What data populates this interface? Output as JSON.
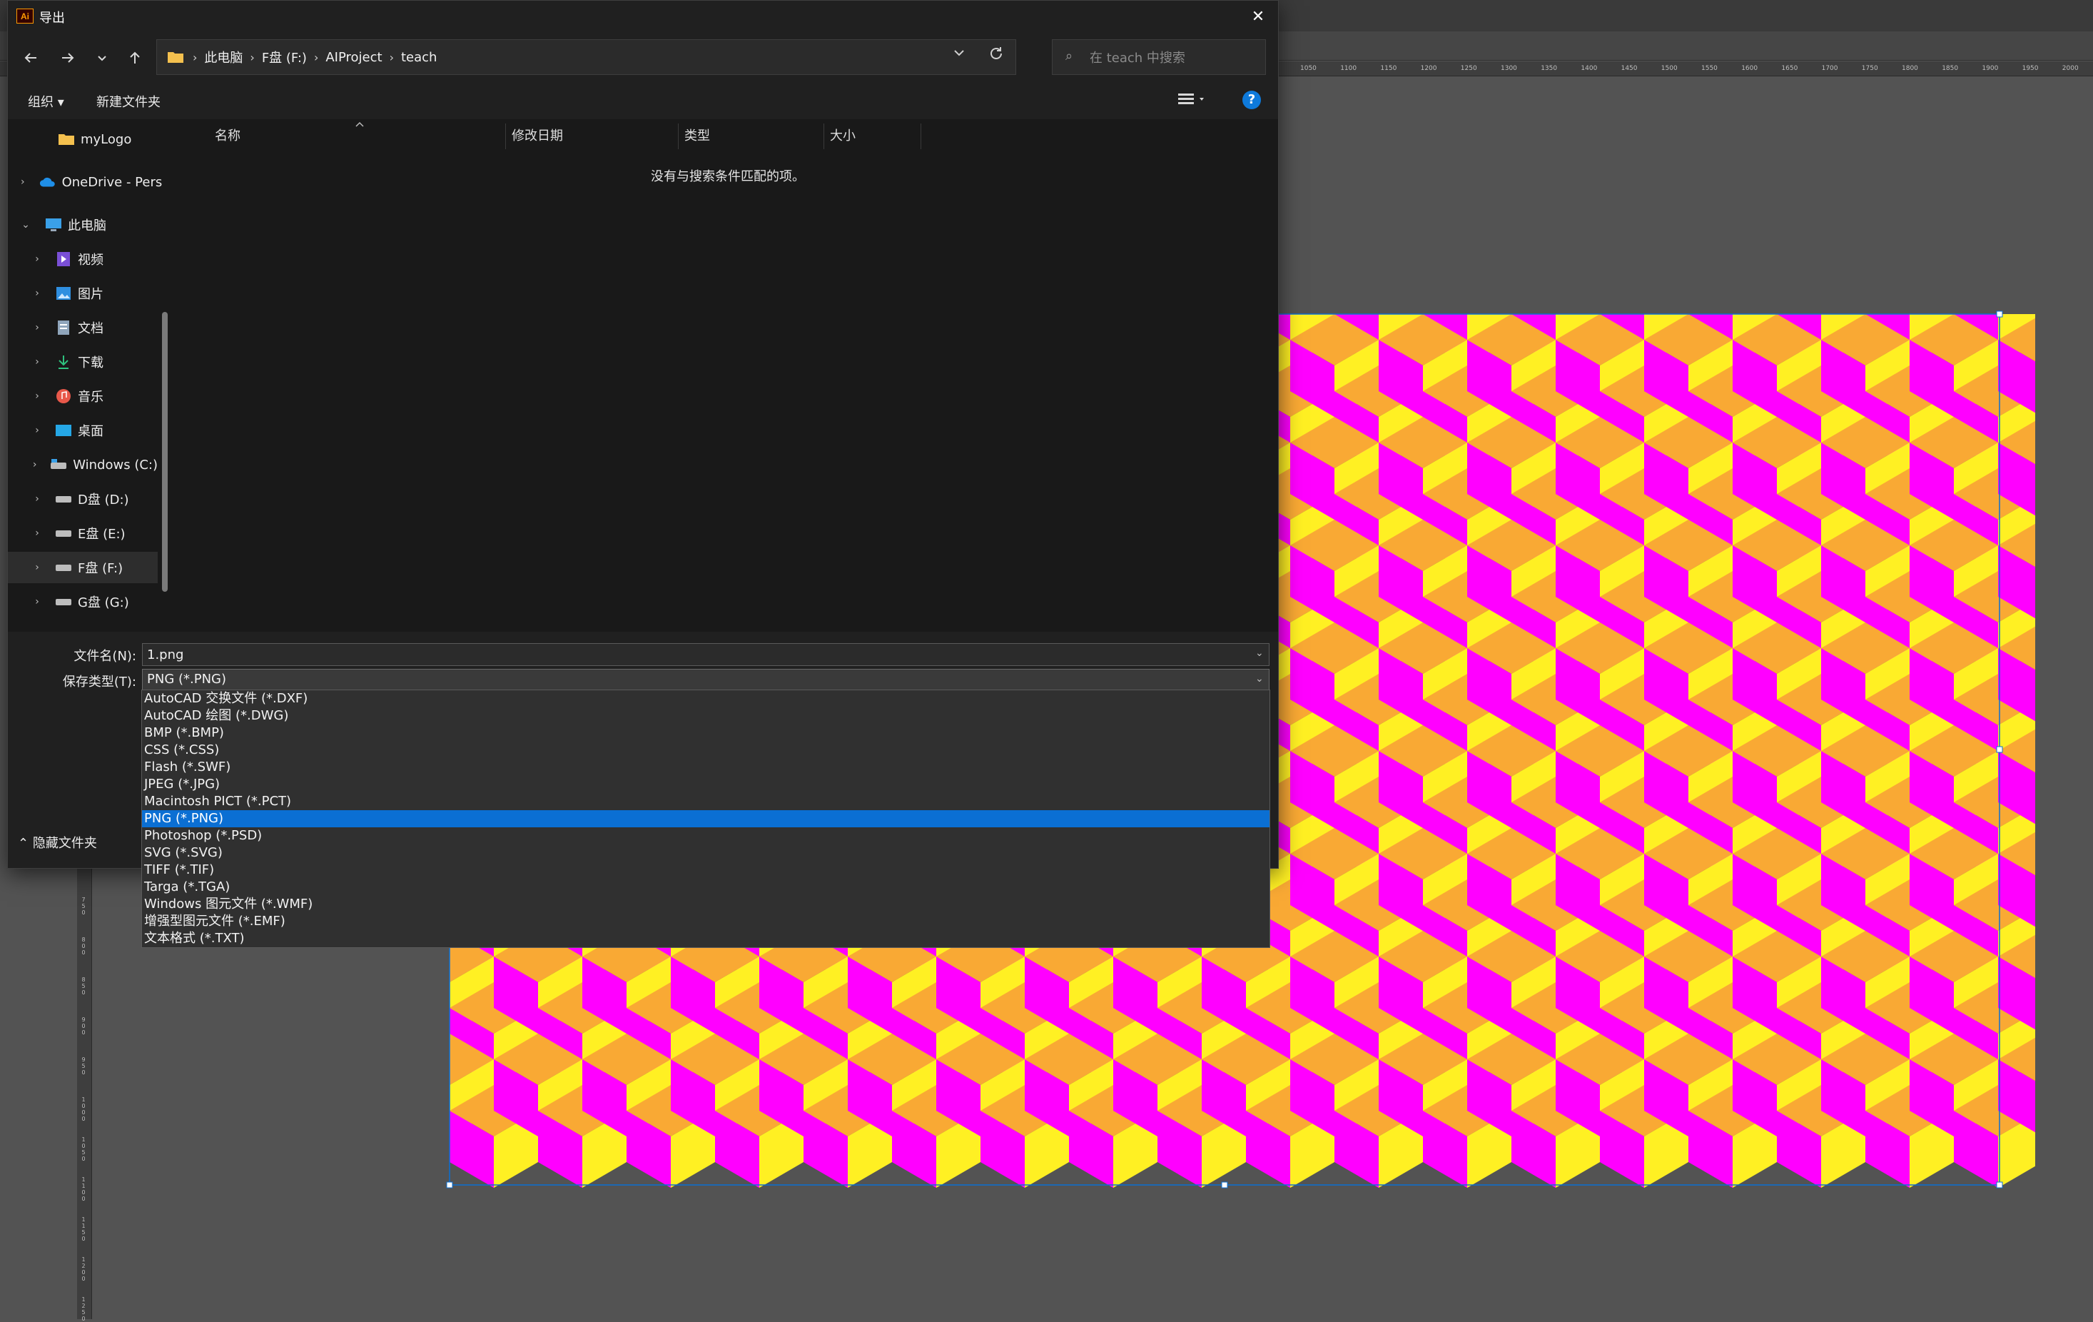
{
  "dialog": {
    "title": "导出",
    "app_icon": "Ai",
    "close": "✕"
  },
  "nav": {
    "breadcrumb": [
      "此电脑",
      "F盘 (F:)",
      "AIProject",
      "teach"
    ],
    "search_placeholder": "在 teach 中搜索"
  },
  "toolbar": {
    "organize": "组织 ▾",
    "new_folder": "新建文件夹",
    "help": "?"
  },
  "sidebar": {
    "items": [
      {
        "label": "myLogo",
        "icon": "folder-icon"
      },
      {
        "label": "OneDrive - Pers",
        "icon": "onedrive-icon"
      },
      {
        "label": "此电脑",
        "icon": "computer-icon"
      },
      {
        "label": "视频",
        "icon": "video-icon"
      },
      {
        "label": "图片",
        "icon": "pictures-icon"
      },
      {
        "label": "文档",
        "icon": "documents-icon"
      },
      {
        "label": "下载",
        "icon": "download-icon"
      },
      {
        "label": "音乐",
        "icon": "music-icon"
      },
      {
        "label": "桌面",
        "icon": "desktop-icon"
      },
      {
        "label": "Windows (C:)",
        "icon": "drive-icon"
      },
      {
        "label": "D盘 (D:)",
        "icon": "drive-icon"
      },
      {
        "label": "E盘 (E:)",
        "icon": "drive-icon"
      },
      {
        "label": "F盘 (F:)",
        "icon": "drive-icon"
      },
      {
        "label": "G盘 (G:)",
        "icon": "drive-icon"
      }
    ]
  },
  "files": {
    "columns": [
      "名称",
      "修改日期",
      "类型",
      "大小"
    ],
    "empty_message": "没有与搜索条件匹配的项。"
  },
  "form": {
    "filename_label": "文件名(N):",
    "filename_value": "1.png",
    "filetype_label": "保存类型(T):",
    "filetype_value": "PNG (*.PNG)",
    "hide_folders": "隐藏文件夹"
  },
  "filetype_options": [
    "AutoCAD 交换文件 (*.DXF)",
    "AutoCAD 绘图 (*.DWG)",
    "BMP (*.BMP)",
    "CSS (*.CSS)",
    "Flash (*.SWF)",
    "JPEG (*.JPG)",
    "Macintosh PICT (*.PCT)",
    "PNG (*.PNG)",
    "Photoshop (*.PSD)",
    "SVG (*.SVG)",
    "TIFF (*.TIF)",
    "Targa (*.TGA)",
    "Windows 图元文件 (*.WMF)",
    "增强型图元文件 (*.EMF)",
    "文本格式 (*.TXT)"
  ],
  "selected_filetype_index": 7,
  "ruler": {
    "top_labels": [
      "1050",
      "1100",
      "1150",
      "1200",
      "1250",
      "1300",
      "1350",
      "1400",
      "1450",
      "1500",
      "1550",
      "1600",
      "1650",
      "1700",
      "1750",
      "1800",
      "1850",
      "1900",
      "1950",
      "2000"
    ],
    "left_labels": [
      "750",
      "800",
      "850",
      "900",
      "950",
      "1000",
      "1050",
      "1100",
      "1150",
      "1200",
      "1250"
    ]
  },
  "artwork_colors": {
    "yellow": "#fff023",
    "magenta": "#ff00ff",
    "orange": "#f9a934",
    "accent": "#0b6fd3"
  }
}
